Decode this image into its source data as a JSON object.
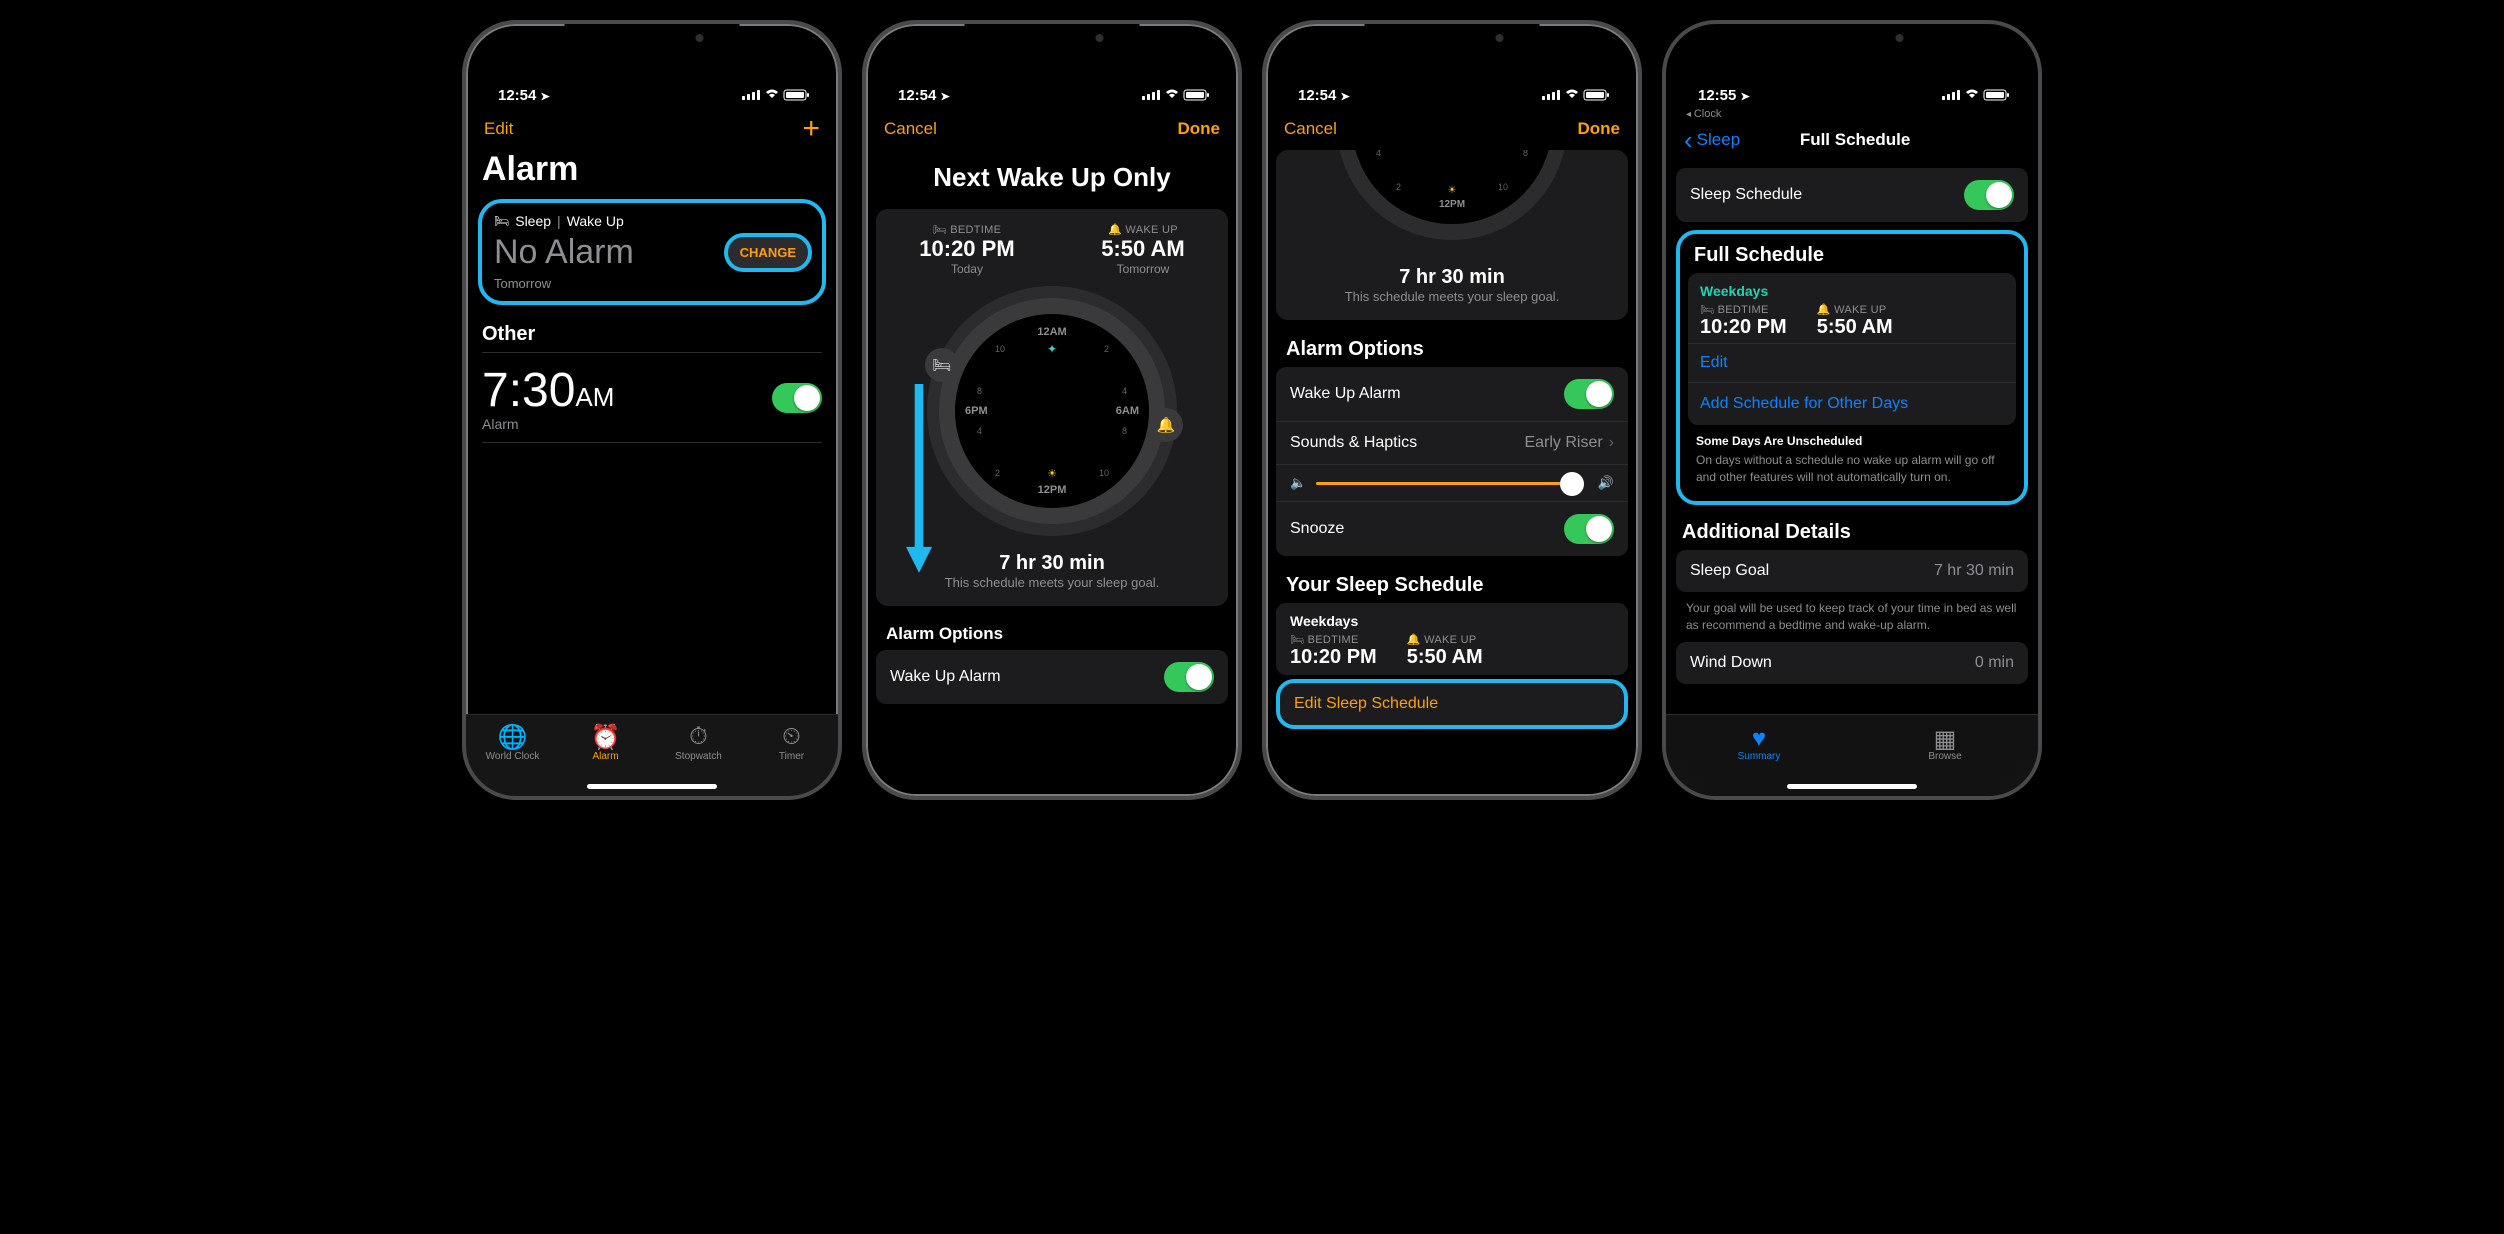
{
  "statusbar": {
    "time_a": "12:54",
    "time_b": "12:55",
    "loc_arrow": "➤"
  },
  "screen1": {
    "nav_left": "Edit",
    "title": "Alarm",
    "sleep_header_a": "Sleep",
    "sleep_header_sep": "|",
    "sleep_header_b": "Wake Up",
    "no_alarm": "No Alarm",
    "change": "CHANGE",
    "tomorrow": "Tomorrow",
    "other": "Other",
    "alarm_time": "7:30",
    "alarm_ampm": "AM",
    "alarm_sub": "Alarm",
    "tabs": [
      "World Clock",
      "Alarm",
      "Stopwatch",
      "Timer"
    ]
  },
  "screen2": {
    "cancel": "Cancel",
    "done": "Done",
    "title": "Next Wake Up Only",
    "bed_lbl": "BEDTIME",
    "bed_time": "10:20 PM",
    "bed_sub": "Today",
    "wake_lbl": "WAKE UP",
    "wake_time": "5:50 AM",
    "wake_sub": "Tomorrow",
    "dial_12am": "12AM",
    "dial_6am": "6AM",
    "dial_12pm": "12PM",
    "dial_6pm": "6PM",
    "goal_time": "7 hr 30 min",
    "goal_sub": "This schedule meets your sleep goal.",
    "alarm_options": "Alarm Options",
    "wake_alarm": "Wake Up Alarm"
  },
  "screen3": {
    "cancel": "Cancel",
    "done": "Done",
    "goal_time": "7 hr 30 min",
    "goal_sub": "This schedule meets your sleep goal.",
    "alarm_options": "Alarm Options",
    "wake_alarm": "Wake Up Alarm",
    "sounds": "Sounds & Haptics",
    "sounds_val": "Early Riser",
    "snooze": "Snooze",
    "your_sched": "Your Sleep Schedule",
    "weekdays": "Weekdays",
    "bed_lbl": "BEDTIME",
    "bed_time": "10:20 PM",
    "wake_lbl": "WAKE UP",
    "wake_time": "5:50 AM",
    "edit_sched": "Edit Sleep Schedule"
  },
  "screen4": {
    "breadcrumb": "Clock",
    "back": "Sleep",
    "title": "Full Schedule",
    "sleep_schedule": "Sleep Schedule",
    "full_schedule": "Full Schedule",
    "weekdays": "Weekdays",
    "bed_lbl": "BEDTIME",
    "bed_time": "10:20 PM",
    "wake_lbl": "WAKE UP",
    "wake_time": "5:50 AM",
    "edit": "Edit",
    "add_other": "Add Schedule for Other Days",
    "note_title": "Some Days Are Unscheduled",
    "note_body": "On days without a schedule no wake up alarm will go off and other features will not automatically turn on.",
    "details": "Additional Details",
    "sleep_goal": "Sleep Goal",
    "sleep_goal_val": "7 hr 30 min",
    "goal_note": "Your goal will be used to keep track of your time in bed as well as recommend a bedtime and wake-up alarm.",
    "wind_down": "Wind Down",
    "wind_down_val": "0 min",
    "tabs": [
      "Summary",
      "Browse"
    ]
  }
}
